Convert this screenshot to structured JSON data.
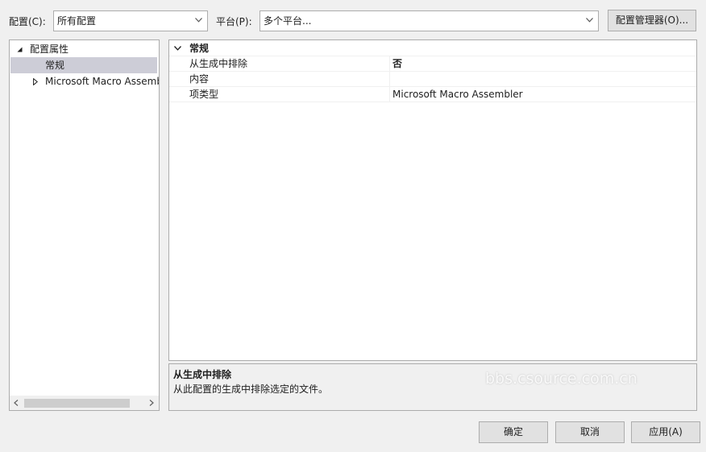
{
  "top": {
    "config_label": "配置(C):",
    "config_value": "所有配置",
    "platform_label": "平台(P):",
    "platform_value": "多个平台...",
    "config_manager_button": "配置管理器(O)..."
  },
  "tree": {
    "items": [
      {
        "label": "配置属性"
      },
      {
        "label": "常规"
      },
      {
        "label": "Microsoft Macro Assembler"
      }
    ]
  },
  "grid": {
    "category": "常规",
    "rows": [
      {
        "name": "从生成中排除",
        "value": "否"
      },
      {
        "name": "内容",
        "value": ""
      },
      {
        "name": "项类型",
        "value": "Microsoft Macro Assembler"
      }
    ]
  },
  "description": {
    "title": "从生成中排除",
    "text": "从此配置的生成中排除选定的文件。"
  },
  "watermark": "bbs.csource.com.cn",
  "buttons": {
    "ok": "确定",
    "cancel": "取消",
    "apply": "应用(A)"
  },
  "colors": {
    "background": "#f0f0f0",
    "selection": "#cdcdd7",
    "border": "#acacac"
  }
}
